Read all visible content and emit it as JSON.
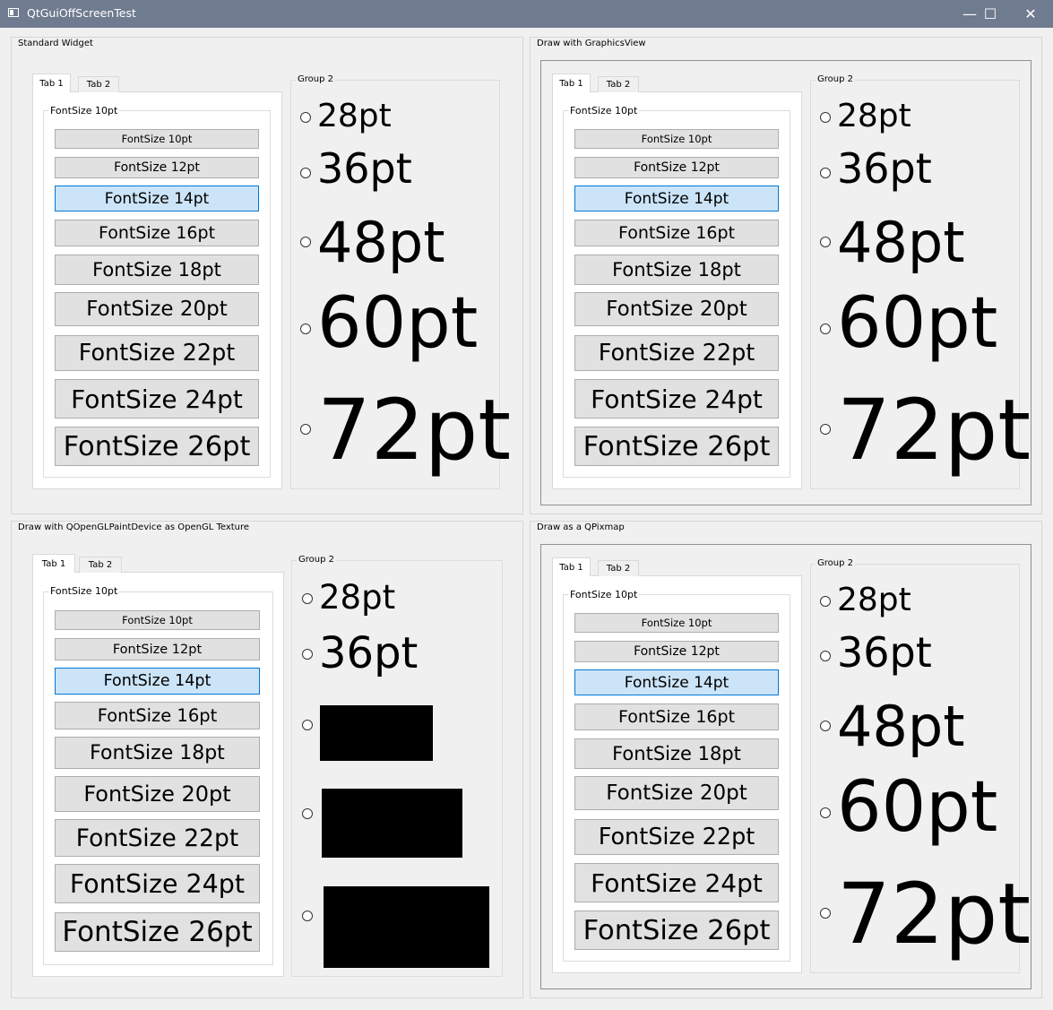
{
  "window": {
    "title": "QtGuiOffScreenTest",
    "controls": {
      "minimize": "—",
      "maximize": "☐",
      "close": "✕"
    }
  },
  "panels": [
    {
      "title": "Standard Widget",
      "tabs": [
        "Tab 1",
        "Tab 2"
      ],
      "group1_title": "FontSize 10pt",
      "group2_title": "Group 2"
    },
    {
      "title": "Draw with GraphicsView",
      "tabs": [
        "Tab 1",
        "Tab 2"
      ],
      "group1_title": "FontSize 10pt",
      "group2_title": "Group 2"
    },
    {
      "title": "Draw with QOpenGLPaintDevice as OpenGL Texture",
      "tabs": [
        "Tab 1",
        "Tab 2"
      ],
      "group1_title": "FontSize 10pt",
      "group2_title": "Group 2",
      "radio_labels_hidden": [
        false,
        false,
        true,
        true,
        true
      ]
    },
    {
      "title": "Draw as a QPixmap",
      "tabs": [
        "Tab 1",
        "Tab 2"
      ],
      "group1_title": "FontSize 10pt",
      "group2_title": "Group 2"
    }
  ],
  "buttons": [
    "FontSize 10pt",
    "FontSize 12pt",
    "FontSize 14pt",
    "FontSize 16pt",
    "FontSize 18pt",
    "FontSize 20pt",
    "FontSize 22pt",
    "FontSize 24pt",
    "FontSize 26pt"
  ],
  "selected_button": 2,
  "radios": [
    "28pt",
    "36pt",
    "48pt",
    "60pt",
    "72pt"
  ],
  "colors": {
    "titlebar": "#6f7b8f",
    "selected_button_bg": "#cce4f7",
    "selected_button_border": "#0078d7",
    "button_bg": "#e1e1e1"
  }
}
